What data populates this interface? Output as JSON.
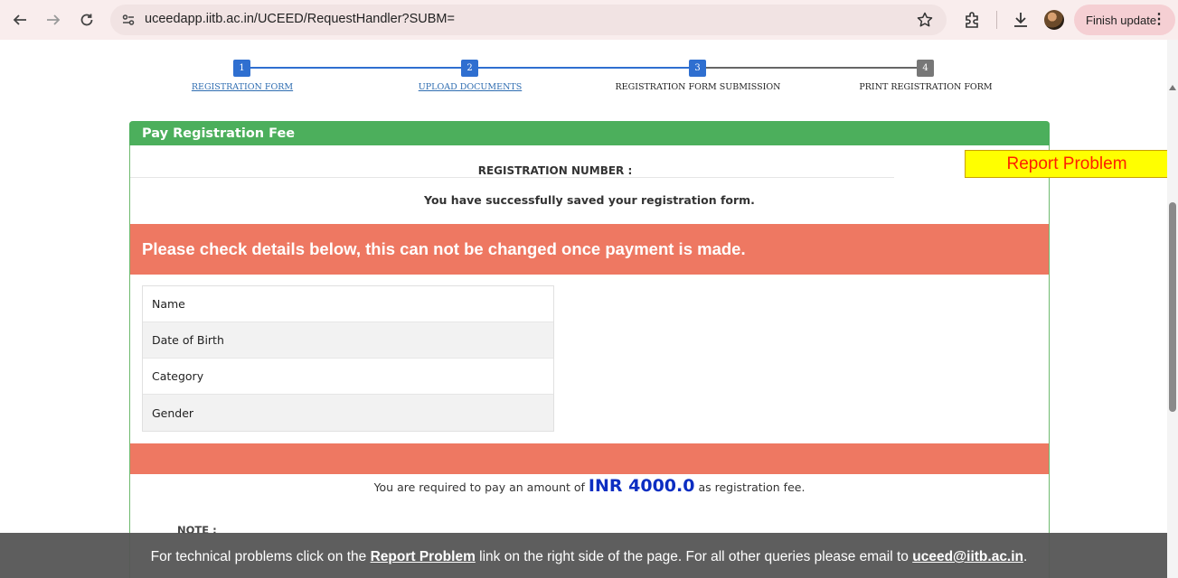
{
  "browser": {
    "url": "uceedapp.iitb.ac.in/UCEED/RequestHandler?SUBM=",
    "finish_update_label": "Finish update",
    "icons": [
      "back-arrow-icon",
      "forward-arrow-icon",
      "reload-icon",
      "site-settings-icon",
      "bookmark-star-icon",
      "extensions-icon",
      "download-icon",
      "profile-avatar",
      "more-menu-icon"
    ]
  },
  "stepper": {
    "steps": [
      {
        "number": "1",
        "label": "REGISTRATION FORM",
        "link": true,
        "color": "#2f6fd0"
      },
      {
        "number": "2",
        "label": "UPLOAD DOCUMENTS",
        "link": true,
        "color": "#2f6fd0"
      },
      {
        "number": "3",
        "label": "REGISTRATION FORM SUBMISSION",
        "link": false,
        "color": "#2f6fd0"
      },
      {
        "number": "4",
        "label": "PRINT REGISTRATION FORM",
        "link": false,
        "color": "#777777"
      }
    ]
  },
  "panel": {
    "title": "Pay Registration Fee",
    "registration_number_label": "REGISTRATION NUMBER :",
    "saved_message": "You have successfully saved your registration form.",
    "warning": "Please check details below, this can not be changed once payment is made.",
    "details": [
      {
        "label": "Name"
      },
      {
        "label": "Date of Birth"
      },
      {
        "label": "Category"
      },
      {
        "label": "Gender"
      }
    ],
    "payment_prefix": "You are required to pay an amount of",
    "payment_amount": "INR 4000.0",
    "payment_suffix": "as registration fee.",
    "note_label": "NOTE :"
  },
  "report_problem": "Report Problem",
  "footer": {
    "text_1": "For technical problems click on the",
    "link_1": "Report Problem",
    "text_2": "link on the right side of the page. For all other queries please email to",
    "link_2": "uceed@iitb.ac.in",
    "text_3": "."
  },
  "colors": {
    "header_green": "#4caf5c",
    "warning_salmon": "#ee7862",
    "amount_blue": "#0c2ec2",
    "report_yellow": "#ffff00",
    "report_red": "#ff2000"
  }
}
